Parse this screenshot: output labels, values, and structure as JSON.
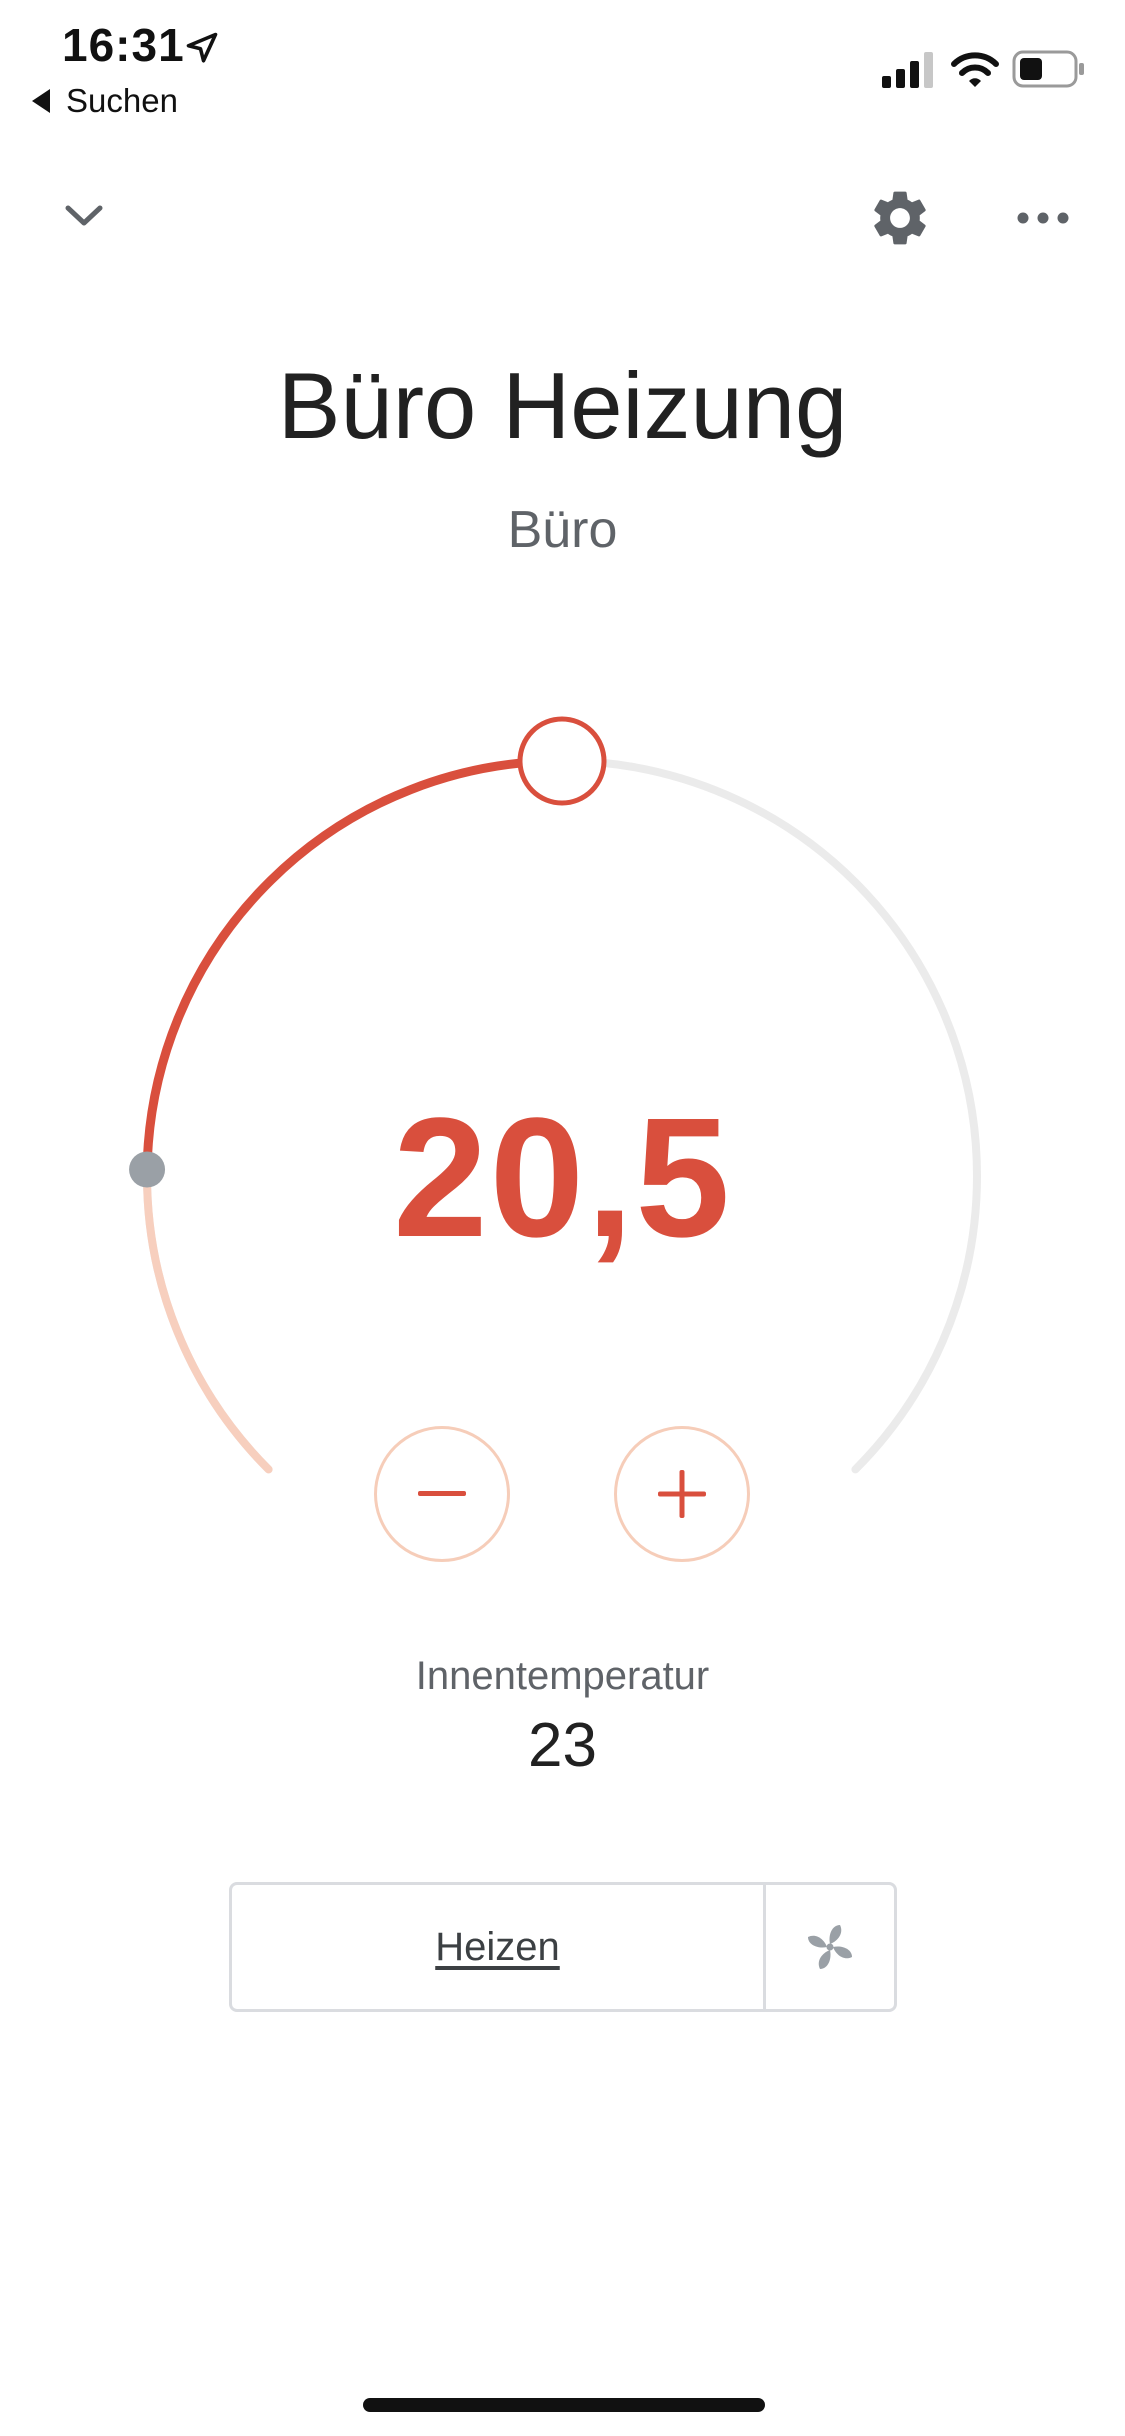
{
  "status_bar": {
    "time": "16:31",
    "back_label": "Suchen",
    "icons": [
      "location-arrow-icon",
      "signal-icon",
      "wifi-icon",
      "battery-icon"
    ]
  },
  "top_bar": {
    "icons": [
      "chevron-down-icon",
      "gear-icon",
      "more-icon"
    ]
  },
  "device": {
    "title": "Büro Heizung",
    "room": "Büro"
  },
  "thermostat": {
    "setpoint": "20,5",
    "setpoint_level": 0.5,
    "current_level": 0.17,
    "minus_symbol": "−",
    "plus_symbol": "+",
    "indoor_label": "Innentemperatur",
    "indoor_value": "23"
  },
  "mode": {
    "label": "Heizen",
    "fan_icon": "fan-icon"
  },
  "colors": {
    "accent": "#d94f3d",
    "accent_light": "#f7cfbe",
    "track": "#ebebeb",
    "current_marker": "#9aa0a6"
  }
}
